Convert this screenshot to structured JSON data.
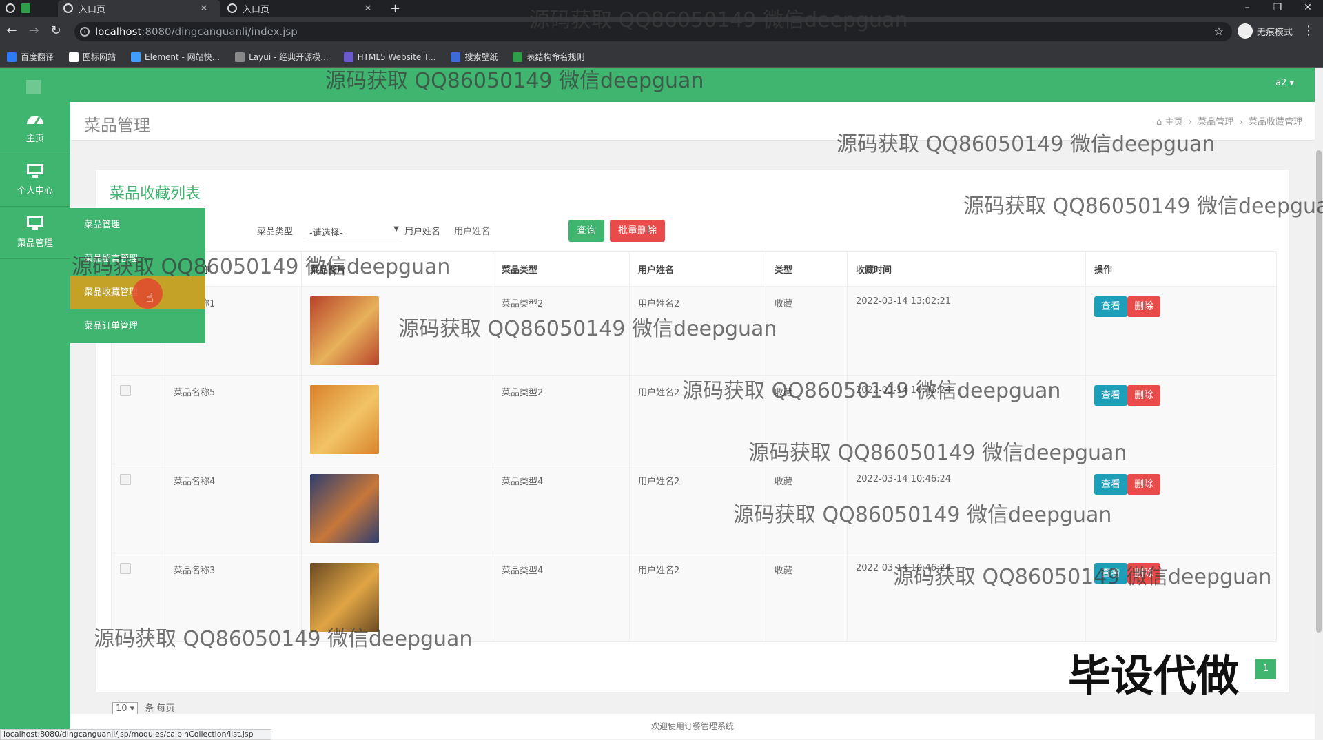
{
  "browser": {
    "tabs": [
      {
        "title": "入口页"
      },
      {
        "title": "入口页"
      }
    ],
    "new_tab": "+",
    "url_host": "localhost",
    "url_path": ":8080/dingcanguanli/index.jsp",
    "incognito_label": "无痕模式",
    "bookmarks": [
      {
        "label": "百度翻译",
        "color": "#2b7cf6"
      },
      {
        "label": "图标网站",
        "color": "#ffffff"
      },
      {
        "label": "Element - 网站快...",
        "color": "#409eff"
      },
      {
        "label": "Layui - 经典开源模...",
        "color": "#888888"
      },
      {
        "label": "HTML5 Website T...",
        "color": "#6a5acd"
      },
      {
        "label": "搜索壁纸",
        "color": "#3d6bd6"
      },
      {
        "label": "表结构命名规则",
        "color": "#2e9e4a"
      }
    ],
    "status_url": "localhost:8080/dingcanguanli/jsp/modules/caipinCollection/list.jsp"
  },
  "header": {
    "user": "a2 ▾"
  },
  "sidebar": {
    "items": [
      {
        "label": "主页",
        "icon": "dashboard-icon"
      },
      {
        "label": "个人中心",
        "icon": "monitor-icon"
      },
      {
        "label": "菜品管理",
        "icon": "monitor-icon"
      }
    ],
    "submenu": [
      "菜品管理",
      "菜品留言管理",
      "菜品收藏管理",
      "菜品订单管理"
    ]
  },
  "content": {
    "page_title": "菜品管理",
    "breadcrumb": [
      "主页",
      "菜品管理",
      "菜品收藏管理"
    ],
    "card_title": "菜品收藏列表",
    "filters": {
      "type_label": "菜品类型",
      "type_value": "-请选择-",
      "user_label": "用户姓名",
      "user_placeholder": "用户姓名",
      "query_btn": "查询",
      "batch_delete_btn": "批量删除"
    },
    "table": {
      "headers": [
        "",
        "菜品名称",
        "菜品图片",
        "菜品类型",
        "用户姓名",
        "类型",
        "收藏时间",
        "操作"
      ],
      "view_label": "查看",
      "delete_label": "删除",
      "rows": [
        {
          "name": "菜品名称1",
          "type": "菜品类型2",
          "user": "用户姓名2",
          "kind": "收藏",
          "time": "2022-03-14 13:02:21",
          "image": "pizza",
          "colors": [
            "#b8432a",
            "#e7b15a"
          ]
        },
        {
          "name": "菜品名称5",
          "type": "菜品类型2",
          "user": "用户姓名2",
          "kind": "收藏",
          "time": "2022-03-14 10:46:24",
          "image": "toast",
          "colors": [
            "#d9822b",
            "#f2c466"
          ]
        },
        {
          "name": "菜品名称4",
          "type": "菜品类型4",
          "user": "用户姓名2",
          "kind": "收藏",
          "time": "2022-03-14 10:46:24",
          "image": "skewers",
          "colors": [
            "#2f3e6e",
            "#c7773a"
          ]
        },
        {
          "name": "菜品名称3",
          "type": "菜品类型4",
          "user": "用户姓名2",
          "kind": "收藏",
          "time": "2022-03-14 10:46:24",
          "image": "fries",
          "colors": [
            "#6b4a22",
            "#e0a545"
          ]
        }
      ]
    },
    "pager": {
      "per_page": "10",
      "per_page_suffix": "条 每页",
      "current_page": "1"
    },
    "footer": "欢迎使用订餐管理系统"
  },
  "watermarks": {
    "text": "源码获取 QQ86050149 微信deepguan",
    "big": "毕设代做"
  }
}
